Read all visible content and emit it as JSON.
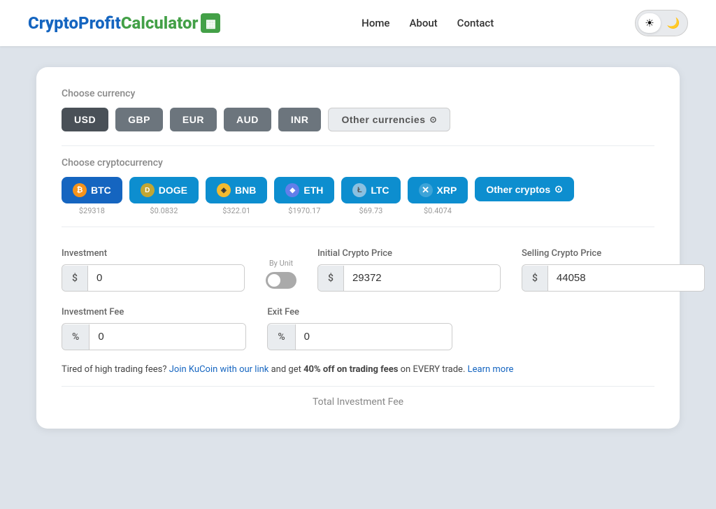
{
  "app": {
    "title": "CryptoProfitCalculator"
  },
  "logo": {
    "part1": "Crypto",
    "part2": "Profit",
    "part3": "Calculator",
    "icon": "▦"
  },
  "nav": {
    "home": "Home",
    "about": "About",
    "contact": "Contact"
  },
  "theme": {
    "sun_icon": "☀",
    "moon_icon": "🌙"
  },
  "currency_section": {
    "label": "Choose currency",
    "buttons": [
      "USD",
      "GBP",
      "EUR",
      "AUD",
      "INR"
    ],
    "other_label": "Other currencies",
    "active": "USD"
  },
  "crypto_section": {
    "label": "Choose cryptocurrency",
    "cryptos": [
      {
        "symbol": "BTC",
        "icon": "₿",
        "icon_class": "icon-btc",
        "price": "$29318"
      },
      {
        "symbol": "DOGE",
        "icon": "D",
        "icon_class": "icon-doge",
        "price": "$0.0832"
      },
      {
        "symbol": "BNB",
        "icon": "◈",
        "icon_class": "icon-bnb",
        "price": "$322.01"
      },
      {
        "symbol": "ETH",
        "icon": "◆",
        "icon_class": "icon-eth",
        "price": "$1970.17"
      },
      {
        "symbol": "LTC",
        "icon": "Ł",
        "icon_class": "icon-ltc",
        "price": "$69.73"
      },
      {
        "symbol": "XRP",
        "icon": "✕",
        "icon_class": "icon-xrp",
        "price": "$0.4074"
      }
    ],
    "other_label": "Other cryptos"
  },
  "form": {
    "by_unit_label": "By Unit",
    "investment_label": "Investment",
    "investment_prefix": "$",
    "investment_value": "0",
    "initial_price_label": "Initial Crypto Price",
    "initial_price_prefix": "$",
    "initial_price_value": "29372",
    "selling_price_label": "Selling Crypto Price",
    "selling_price_prefix": "$",
    "selling_price_value": "44058",
    "investment_fee_label": "Investment Fee",
    "investment_fee_prefix": "%",
    "investment_fee_value": "0",
    "exit_fee_label": "Exit Fee",
    "exit_fee_prefix": "%",
    "exit_fee_value": "0"
  },
  "promo": {
    "text1": "Tired of high trading fees? ",
    "link1": "Join KuCoin with our link",
    "text2": " and get ",
    "bold": "40% off on trading fees",
    "text3": " on EVERY trade. ",
    "link2": "Learn more"
  },
  "total": {
    "label": "Total Investment Fee"
  }
}
